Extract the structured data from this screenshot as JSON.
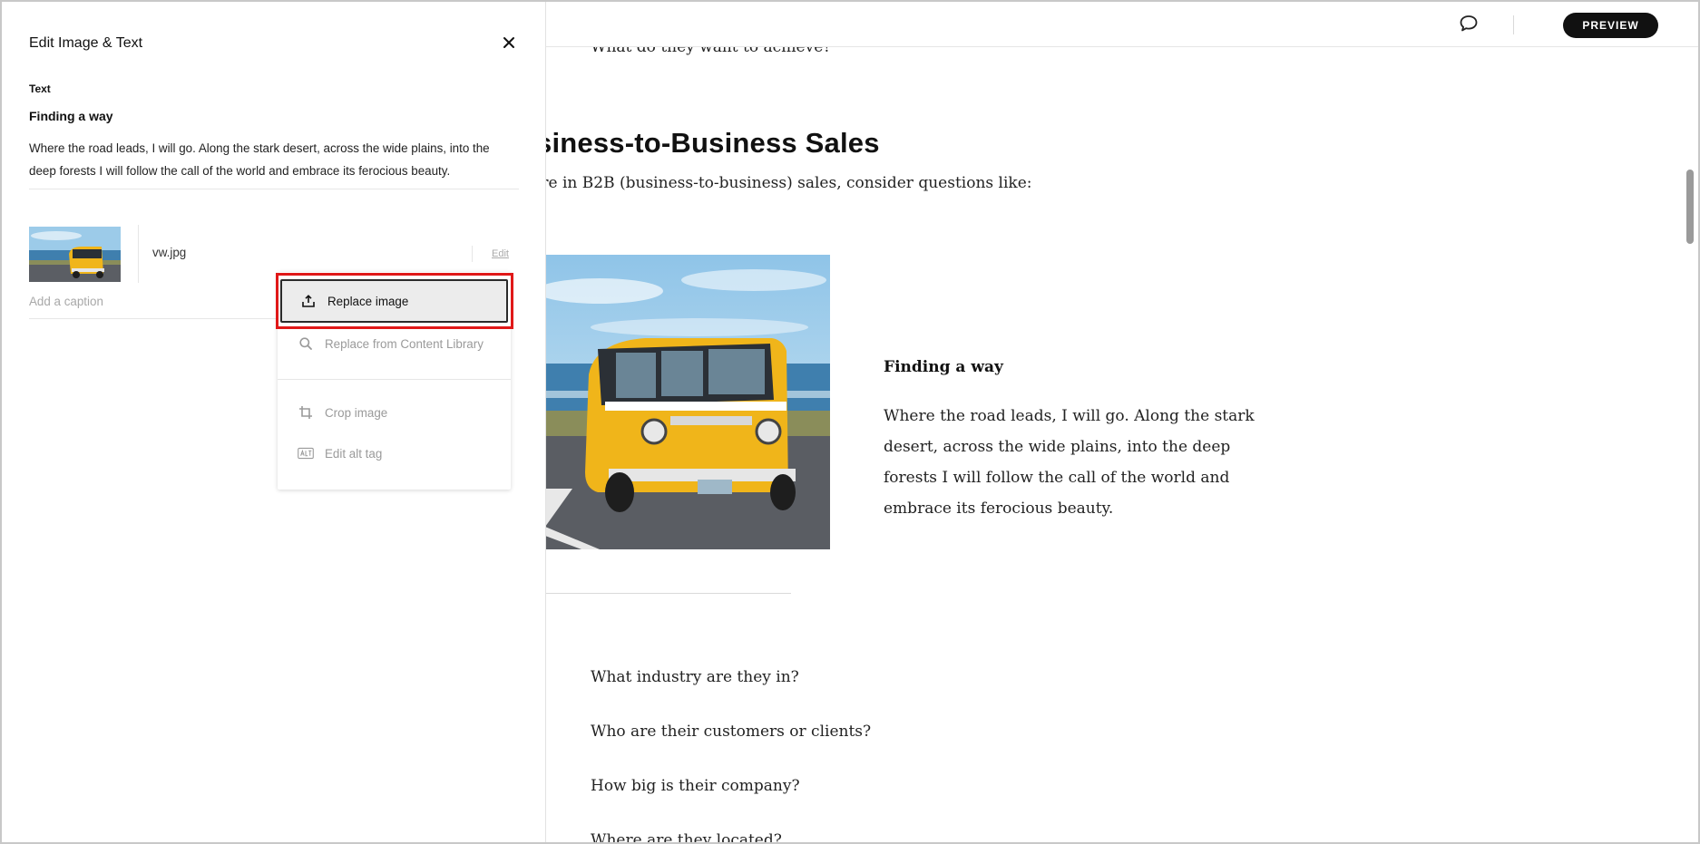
{
  "topbar": {
    "comment_icon": "speech-bubble-icon",
    "preview_label": "PREVIEW"
  },
  "content": {
    "question_top": "What do they want to achieve?",
    "heading": "siness-to-Business Sales",
    "intro": "’re in B2B (business-to-business) sales, consider questions like:",
    "image": "yellow-vw-bus-photo",
    "side_title": "Finding a way",
    "side_body": "Where the road leads, I will go. Along the stark desert, across the wide plains, into the deep forests I will follow the call of the world and embrace its ferocious beauty.",
    "questions": [
      "What industry are they in?",
      "Who are their customers or clients?",
      "How big is their company?",
      "Where are they located?"
    ]
  },
  "panel": {
    "title": "Edit Image & Text",
    "close_icon": "close-x-icon",
    "text_section_label": "Text",
    "text_title": "Finding a way",
    "text_body": "Where the road leads, I will go. Along the stark desert, across the wide plains, into the deep forests I will follow the call of the world and embrace its ferocious beauty.",
    "file_name": "vw.jpg",
    "edit_label": "Edit",
    "caption_placeholder": "Add a caption"
  },
  "menu": {
    "items": [
      {
        "label": "Replace image",
        "icon": "upload-icon",
        "state": "active"
      },
      {
        "label": "Replace from Content Library",
        "icon": "search-icon",
        "state": "disabled"
      },
      {
        "label": "Crop image",
        "icon": "crop-icon",
        "state": "disabled"
      },
      {
        "label": "Edit alt tag",
        "icon": "alt-tag-icon",
        "state": "disabled"
      }
    ]
  },
  "colors": {
    "highlight": "#e01818",
    "preview_button": "#111111",
    "bus_yellow": "#f0b51a",
    "text_dark": "#222222",
    "text_muted": "#9a9a9a"
  }
}
